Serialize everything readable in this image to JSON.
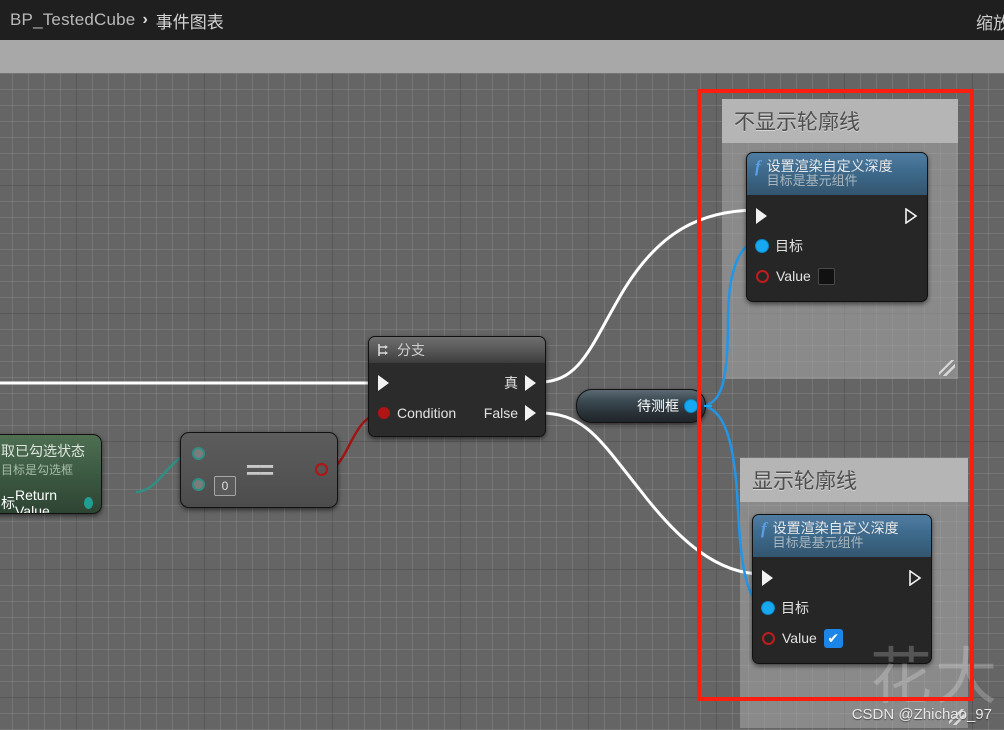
{
  "breadcrumb": {
    "root": "BP_TestedCube",
    "separator": "›",
    "current": "事件图表"
  },
  "toolbar": {
    "zoom_label": "缩放"
  },
  "comments": [
    {
      "title": "不显示轮廓线"
    },
    {
      "title": "显示轮廓线"
    }
  ],
  "nodes": {
    "get_checked_state": {
      "title": "取已勾选状态",
      "subtitle": "目标是勾选框",
      "target_label": "标",
      "return_label": "Return Value"
    },
    "equals": {
      "operator": "==",
      "value": "0"
    },
    "branch": {
      "title": "分支",
      "condition_label": "Condition",
      "true_label": "真",
      "false_label": "False"
    },
    "variable": {
      "label": "待测框"
    },
    "set_depth_hide": {
      "title": "设置渲染自定义深度",
      "subtitle": "目标是基元组件",
      "target_label": "目标",
      "value_label": "Value",
      "value_checked": false
    },
    "set_depth_show": {
      "title": "设置渲染自定义深度",
      "subtitle": "目标是基元组件",
      "target_label": "目标",
      "value_label": "Value",
      "value_checked": true,
      "checkmark": "✔"
    }
  },
  "watermark": {
    "csdn": "CSDN @Zhichao_97",
    "big": "花大"
  },
  "colors": {
    "annotation_red": "#fa1e0e",
    "exec_wire": "#ffffff",
    "data_wire_blue": "#2196e8",
    "data_wire_red": "#a01414",
    "data_wire_teal": "#2f8f83",
    "canvas": "#656565"
  }
}
